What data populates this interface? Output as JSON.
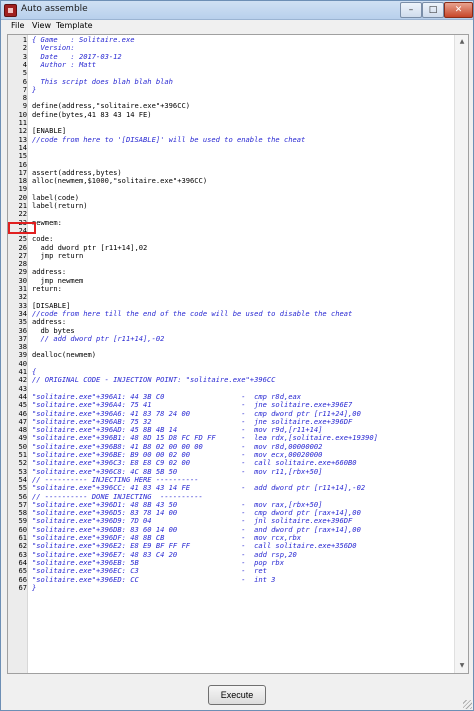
{
  "window": {
    "title": "Auto assemble"
  },
  "controls": {
    "minimize": "–",
    "maximize": "□",
    "close": "✕"
  },
  "menu": [
    "File",
    "View",
    "Template"
  ],
  "editor": {
    "highlight_line": "26",
    "lines": [
      {
        "n": "1",
        "t": "{ Game   : Solitaire.exe",
        "k": "comment"
      },
      {
        "n": "2",
        "t": "  Version:",
        "k": "comment"
      },
      {
        "n": "3",
        "t": "  Date   : 2017-03-12",
        "k": "comment"
      },
      {
        "n": "4",
        "t": "  Author : Matt",
        "k": "comment"
      },
      {
        "n": "5",
        "t": "",
        "k": "text"
      },
      {
        "n": "6",
        "t": "  This script does blah blah blah",
        "k": "comment"
      },
      {
        "n": "7",
        "t": "}",
        "k": "comment"
      },
      {
        "n": "8",
        "t": "",
        "k": "text"
      },
      {
        "n": "9",
        "t": "define(address,\"solitaire.exe\"+396CC)",
        "k": "text"
      },
      {
        "n": "10",
        "t": "define(bytes,41 83 43 14 FE)",
        "k": "text"
      },
      {
        "n": "11",
        "t": "",
        "k": "text"
      },
      {
        "n": "12",
        "t": "[ENABLE]",
        "k": "text"
      },
      {
        "n": "13",
        "t": "//code from here to '[DISABLE]' will be used to enable the cheat",
        "k": "comment"
      },
      {
        "n": "14",
        "t": "",
        "k": "text"
      },
      {
        "n": "15",
        "t": "",
        "k": "text"
      },
      {
        "n": "16",
        "t": "",
        "k": "text"
      },
      {
        "n": "17",
        "t": "assert(address,bytes)",
        "k": "text"
      },
      {
        "n": "18",
        "t": "alloc(newmem,$1000,\"solitaire.exe\"+396CC)",
        "k": "text"
      },
      {
        "n": "19",
        "t": "",
        "k": "text"
      },
      {
        "n": "20",
        "t": "label(code)",
        "k": "text"
      },
      {
        "n": "21",
        "t": "label(return)",
        "k": "text"
      },
      {
        "n": "22",
        "t": "",
        "k": "text"
      },
      {
        "n": "23",
        "t": "newmem:",
        "k": "text"
      },
      {
        "n": "24",
        "t": "",
        "k": "text"
      },
      {
        "n": "25",
        "t": "code:",
        "k": "text"
      },
      {
        "n": "26",
        "t": "  add dword ptr [r11+14],02",
        "k": "text"
      },
      {
        "n": "27",
        "t": "  jmp return",
        "k": "text"
      },
      {
        "n": "28",
        "t": "",
        "k": "text"
      },
      {
        "n": "29",
        "t": "address:",
        "k": "text"
      },
      {
        "n": "30",
        "t": "  jmp newmem",
        "k": "text"
      },
      {
        "n": "31",
        "t": "return:",
        "k": "text"
      },
      {
        "n": "32",
        "t": "",
        "k": "text"
      },
      {
        "n": "33",
        "t": "[DISABLE]",
        "k": "text"
      },
      {
        "n": "34",
        "t": "//code from here till the end of the code will be used to disable the cheat",
        "k": "comment"
      },
      {
        "n": "35",
        "t": "address:",
        "k": "text"
      },
      {
        "n": "36",
        "t": "  db bytes",
        "k": "text"
      },
      {
        "n": "37",
        "t": "  // add dword ptr [r11+14],-02",
        "k": "comment"
      },
      {
        "n": "38",
        "t": "",
        "k": "text"
      },
      {
        "n": "39",
        "t": "dealloc(newmem)",
        "k": "text"
      },
      {
        "n": "40",
        "t": "",
        "k": "text"
      },
      {
        "n": "41",
        "t": "{",
        "k": "comment"
      },
      {
        "n": "42",
        "t": "// ORIGINAL CODE - INJECTION POINT: \"solitaire.exe\"+396CC",
        "k": "comment"
      },
      {
        "n": "43",
        "t": "",
        "k": "text"
      },
      {
        "n": "44",
        "t": "\"solitaire.exe\"+396A1: 44 3B C0                  -  cmp r8d,eax",
        "k": "comment"
      },
      {
        "n": "45",
        "t": "\"solitaire.exe\"+396A4: 75 41                     -  jne solitaire.exe+396E7",
        "k": "comment"
      },
      {
        "n": "46",
        "t": "\"solitaire.exe\"+396A6: 41 83 78 24 00            -  cmp dword ptr [r11+24],00",
        "k": "comment"
      },
      {
        "n": "47",
        "t": "\"solitaire.exe\"+396AB: 75 32                     -  jne solitaire.exe+396DF",
        "k": "comment"
      },
      {
        "n": "48",
        "t": "\"solitaire.exe\"+396AD: 45 8B 4B 14               -  mov r9d,[r11+14]",
        "k": "comment"
      },
      {
        "n": "49",
        "t": "\"solitaire.exe\"+396B1: 48 8D 15 D8 FC FD FF      -  lea rdx,[solitaire.exe+19390]",
        "k": "comment"
      },
      {
        "n": "50",
        "t": "\"solitaire.exe\"+396B8: 41 B8 02 00 00 00         -  mov r8d,00000002",
        "k": "comment"
      },
      {
        "n": "51",
        "t": "\"solitaire.exe\"+396BE: B9 00 00 02 00            -  mov ecx,00020000",
        "k": "comment"
      },
      {
        "n": "52",
        "t": "\"solitaire.exe\"+396C3: E8 E8 C9 02 00            -  call solitaire.exe+660B0",
        "k": "comment"
      },
      {
        "n": "53",
        "t": "\"solitaire.exe\"+396C8: 4C 8B 5B 50               -  mov r11,[rbx+50]",
        "k": "comment"
      },
      {
        "n": "54",
        "t": "// ---------- INJECTING HERE ----------",
        "k": "comment"
      },
      {
        "n": "55",
        "t": "\"solitaire.exe\"+396CC: 41 83 43 14 FE            -  add dword ptr [r11+14],-02",
        "k": "comment"
      },
      {
        "n": "56",
        "t": "// ---------- DONE INJECTING  ----------",
        "k": "comment"
      },
      {
        "n": "57",
        "t": "\"solitaire.exe\"+396D1: 48 8B 43 50               -  mov rax,[rbx+50]",
        "k": "comment"
      },
      {
        "n": "58",
        "t": "\"solitaire.exe\"+396D5: 83 78 14 00               -  cmp dword ptr [rax+14],00",
        "k": "comment"
      },
      {
        "n": "59",
        "t": "\"solitaire.exe\"+396D9: 7D 04                     -  jnl solitaire.exe+396DF",
        "k": "comment"
      },
      {
        "n": "60",
        "t": "\"solitaire.exe\"+396DB: 83 60 14 00               -  and dword ptr [rax+14],00",
        "k": "comment"
      },
      {
        "n": "61",
        "t": "\"solitaire.exe\"+396DF: 48 8B CB                  -  mov rcx,rbx",
        "k": "comment"
      },
      {
        "n": "62",
        "t": "\"solitaire.exe\"+396E2: E8 E9 BF FF FF            -  call solitaire.exe+356D0",
        "k": "comment"
      },
      {
        "n": "63",
        "t": "\"solitaire.exe\"+396E7: 48 83 C4 20               -  add rsp,20",
        "k": "comment"
      },
      {
        "n": "64",
        "t": "\"solitaire.exe\"+396EB: 5B                        -  pop rbx",
        "k": "comment"
      },
      {
        "n": "65",
        "t": "\"solitaire.exe\"+396EC: C3                        -  ret",
        "k": "comment"
      },
      {
        "n": "66",
        "t": "\"solitaire.exe\"+396ED: CC                        -  int 3",
        "k": "comment"
      },
      {
        "n": "67",
        "t": "}",
        "k": "comment"
      }
    ]
  },
  "scrollbar": {
    "up": "▲",
    "down": "▼"
  },
  "footer": {
    "execute_label": "Execute"
  }
}
